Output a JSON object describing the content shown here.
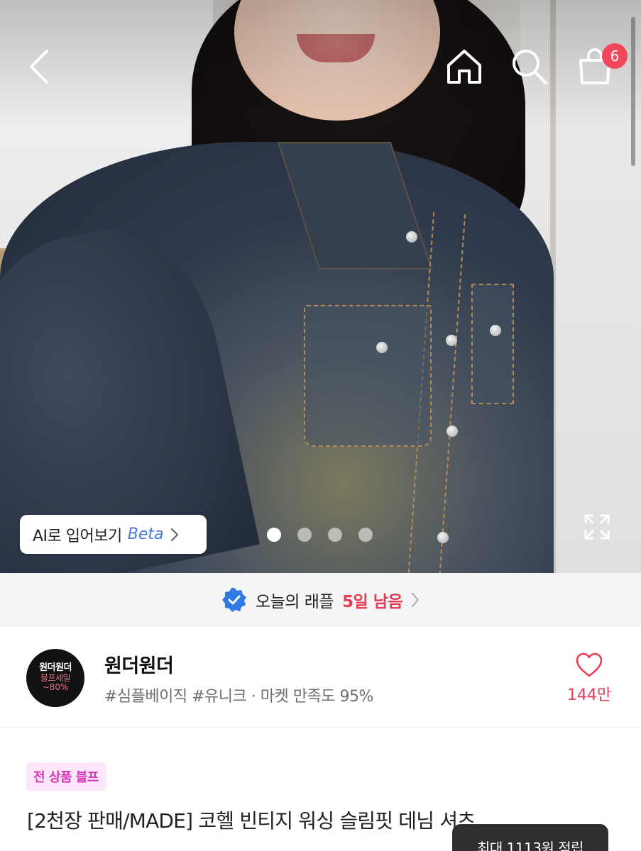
{
  "nav": {
    "cart_count": "6"
  },
  "hero": {
    "ai_tryon_label": "AI로 입어보기",
    "ai_tryon_beta": "Beta",
    "slide_count": 4,
    "active_slide": 1
  },
  "raffle": {
    "label": "오늘의 래플",
    "remaining": "5일 남음"
  },
  "shop": {
    "logo_line1": "원더원더",
    "logo_line2": "블프세일",
    "logo_line3": "~80%",
    "name": "원더원더",
    "tags": "#심플베이직 #유니크 · 마켓 만족도 95%",
    "likes": "144만"
  },
  "product": {
    "badge": "전 상품 블프",
    "title": "[2천장 판매/MADE] 코헬 빈티지 워싱 슬림핏 데님 셔츠"
  },
  "toast": {
    "text": "최대 1113원 적립"
  },
  "colors": {
    "accent_red": "#ea3b54",
    "badge_pink": "#d733b6",
    "verified_blue": "#2f7ae5"
  }
}
